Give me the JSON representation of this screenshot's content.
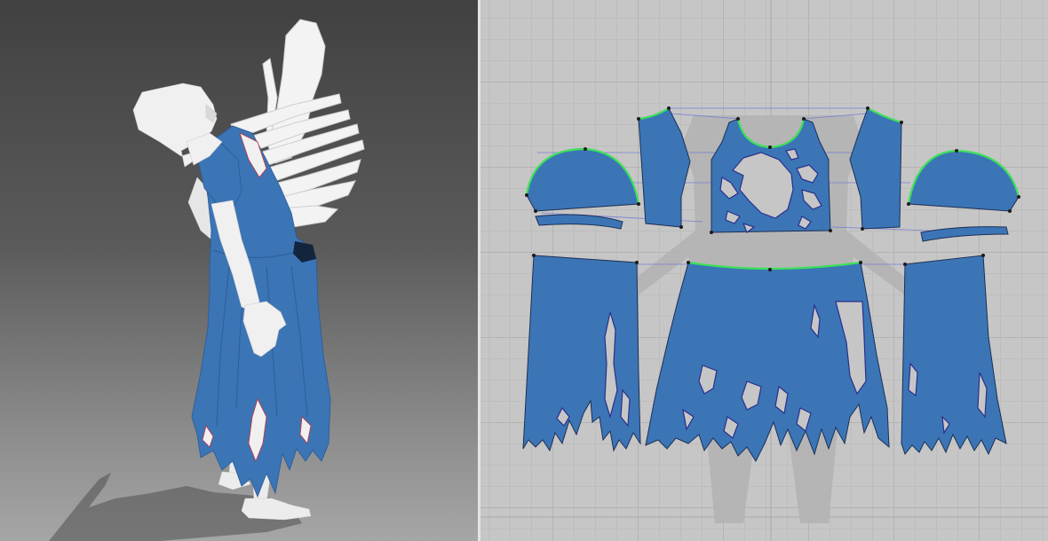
{
  "app": {
    "views": [
      {
        "name": "3d-garment-view"
      },
      {
        "name": "2d-pattern-view"
      }
    ]
  },
  "colors": {
    "garment": "#3b75b6",
    "avatar": "#f0f0f0",
    "grid_background": "#c6c6c6",
    "seam_highlight": "#3de05a",
    "seam_link": "#6f78d8"
  },
  "pattern_pieces": [
    {
      "name": "left-sleeve-cap"
    },
    {
      "name": "left-sleeve-cuff"
    },
    {
      "name": "left-back-bodice"
    },
    {
      "name": "front-bodice"
    },
    {
      "name": "right-back-bodice"
    },
    {
      "name": "right-sleeve-cap"
    },
    {
      "name": "right-sleeve-cuff"
    },
    {
      "name": "left-back-skirt"
    },
    {
      "name": "front-skirt"
    },
    {
      "name": "right-back-skirt"
    }
  ]
}
